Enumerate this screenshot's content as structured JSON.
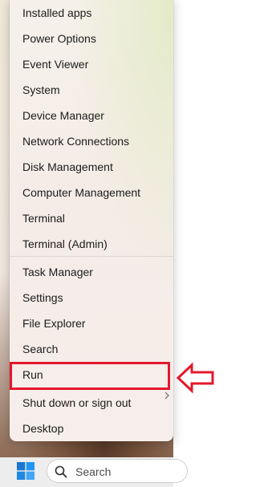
{
  "menu": {
    "group1": [
      {
        "label": "Installed apps"
      },
      {
        "label": "Power Options"
      },
      {
        "label": "Event Viewer"
      },
      {
        "label": "System"
      },
      {
        "label": "Device Manager"
      },
      {
        "label": "Network Connections"
      },
      {
        "label": "Disk Management"
      },
      {
        "label": "Computer Management"
      },
      {
        "label": "Terminal"
      },
      {
        "label": "Terminal (Admin)"
      }
    ],
    "group2": [
      {
        "label": "Task Manager"
      },
      {
        "label": "Settings"
      },
      {
        "label": "File Explorer"
      },
      {
        "label": "Search"
      },
      {
        "label": "Run"
      },
      {
        "label": "Shut down or sign out"
      },
      {
        "label": "Desktop"
      }
    ]
  },
  "annotation": {
    "color": "#e3182d",
    "highlighted_item": "Run",
    "arrow_icon": "left-arrow-icon"
  },
  "taskbar": {
    "start_icon": "windows-logo-icon",
    "search": {
      "label": "Search",
      "icon": "search-icon"
    }
  }
}
